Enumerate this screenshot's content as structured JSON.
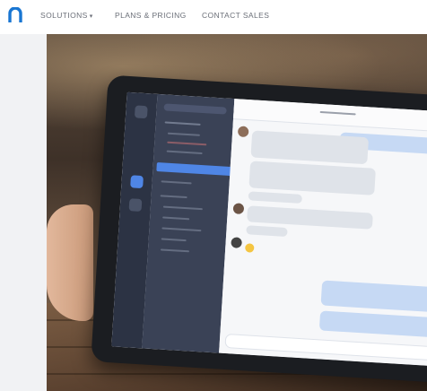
{
  "nav": {
    "items": [
      {
        "label": "SOLUTIONS"
      },
      {
        "label": "PLANS & PRICING"
      },
      {
        "label": "CONTACT SALES"
      }
    ],
    "caret_icon": "chevron-down-icon",
    "logo_icon": "n-logo-icon",
    "logo_color": "#1976d2",
    "text_color": "#6b6f78"
  },
  "hero": {
    "image_subject": "tablet-chat-app-photo"
  }
}
